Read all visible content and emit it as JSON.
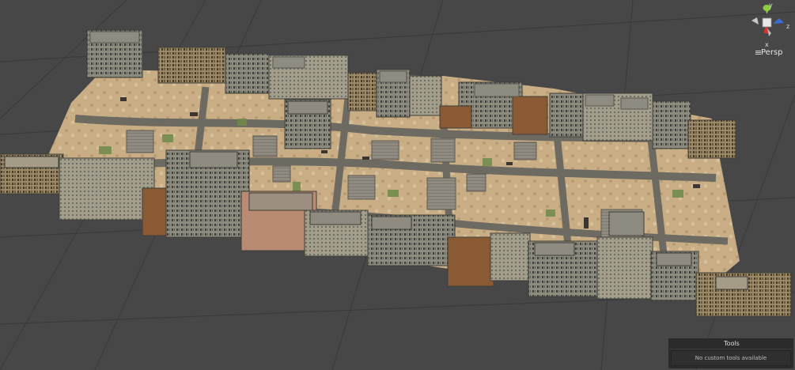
{
  "scene": {
    "background_color": "#474747",
    "grid_color": "#3a3a3a"
  },
  "gizmo": {
    "projection_label": "Persp",
    "axis_y_label": "y",
    "axis_z_label": "z",
    "axis_x_label": "x",
    "projection_icon": "menu-lines-icon"
  },
  "tools": {
    "title": "Tools",
    "empty_message": "No custom tools available"
  }
}
